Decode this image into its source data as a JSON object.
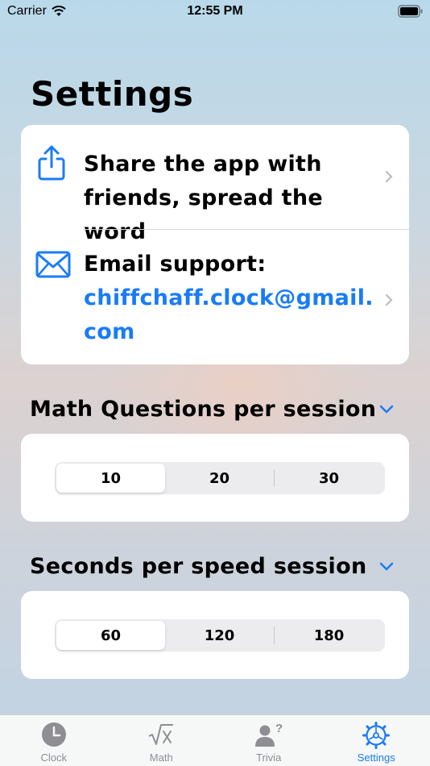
{
  "status_bar": {
    "carrier": "Carrier",
    "time": "12:55 PM"
  },
  "page": {
    "title": "Settings"
  },
  "links": [
    {
      "icon": "share-icon",
      "text": "Share the app with friends, spread the word"
    },
    {
      "icon": "envelope-icon",
      "label": "Email support:",
      "email": "chiffchaff.clock@gmail.com"
    }
  ],
  "math_questions": {
    "title": "Math Questions per session",
    "options": [
      "10",
      "20",
      "30"
    ],
    "selected": "10"
  },
  "speed_seconds": {
    "title": "Seconds per speed session",
    "options": [
      "60",
      "120",
      "180"
    ],
    "selected": "60"
  },
  "tabbar": {
    "tabs": [
      {
        "label": "Clock",
        "icon": "clock-icon"
      },
      {
        "label": "Math",
        "icon": "square-root-icon"
      },
      {
        "label": "Trivia",
        "icon": "person-question-icon"
      },
      {
        "label": "Settings",
        "icon": "gear-icon"
      }
    ],
    "active": "Settings"
  },
  "colors": {
    "accent": "#1a7cf5",
    "card": "#ffffff",
    "segmented_bg": "#ececee"
  }
}
